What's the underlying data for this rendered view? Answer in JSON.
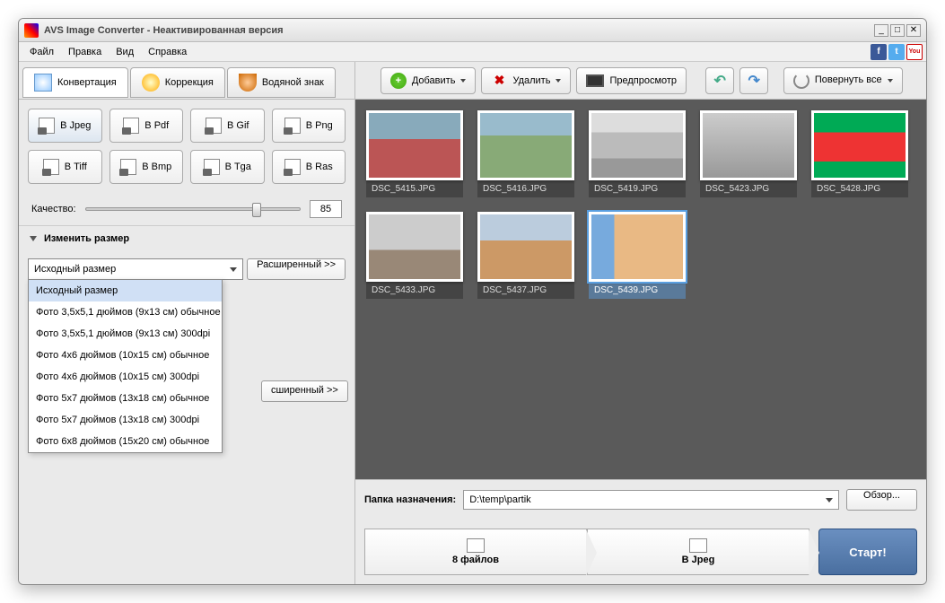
{
  "titlebar": {
    "title": "AVS Image Converter - Неактивированная версия"
  },
  "menu": {
    "file": "Файл",
    "edit": "Правка",
    "view": "Вид",
    "help": "Справка"
  },
  "tabs": {
    "convert": "Конвертация",
    "correct": "Коррекция",
    "watermark": "Водяной знак"
  },
  "formats": {
    "jpeg": "В Jpeg",
    "pdf": "В Pdf",
    "gif": "В Gif",
    "png": "В Png",
    "tiff": "В Tiff",
    "bmp": "В Bmp",
    "tga": "В Tga",
    "ras": "В Ras"
  },
  "quality": {
    "label": "Качество:",
    "value": "85"
  },
  "resize": {
    "title": "Изменить размер",
    "selected": "Исходный размер",
    "advanced": "Расширенный >>",
    "options": [
      "Исходный размер",
      "Фото 3,5x5,1 дюймов (9x13 см) обычное",
      "Фото 3,5x5,1 дюймов (9x13 см) 300dpi",
      "Фото 4x6 дюймов (10x15 см) обычное",
      "Фото 4x6 дюймов (10x15 см) 300dpi",
      "Фото 5x7 дюймов (13x18 см) обычное",
      "Фото 5x7 дюймов (13x18 см) 300dpi",
      "Фото 6x8 дюймов (15x20 см) обычное"
    ]
  },
  "section2_advanced": "сширенный >>",
  "toolbar": {
    "add": "Добавить",
    "delete": "Удалить",
    "preview": "Предпросмотр",
    "rotate": "Повернуть все"
  },
  "thumbs": [
    {
      "name": "DSC_5415.JPG"
    },
    {
      "name": "DSC_5416.JPG"
    },
    {
      "name": "DSC_5419.JPG"
    },
    {
      "name": "DSC_5423.JPG"
    },
    {
      "name": "DSC_5428.JPG"
    },
    {
      "name": "DSC_5433.JPG"
    },
    {
      "name": "DSC_5437.JPG"
    },
    {
      "name": "DSC_5439.JPG"
    }
  ],
  "selected_thumb": 7,
  "dest": {
    "label": "Папка назначения:",
    "path": "D:\\temp\\partik",
    "browse": "Обзор..."
  },
  "flow": {
    "files": "8 файлов",
    "format": "В Jpeg",
    "start": "Старт!"
  }
}
